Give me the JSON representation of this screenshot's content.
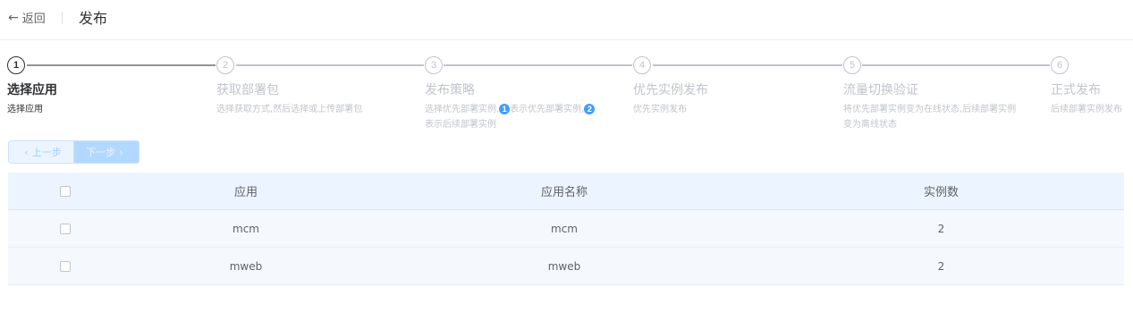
{
  "header": {
    "back_label": "返回",
    "title": "发布"
  },
  "steps": [
    {
      "number": "1",
      "title": "选择应用",
      "desc": [
        "选择应用"
      ]
    },
    {
      "number": "2",
      "title": "获取部署包",
      "desc": [
        "选择获取方式,然后选择或上传部署包"
      ]
    },
    {
      "number": "3",
      "title": "发布策略",
      "desc_prefix": "选择优先部署实例,",
      "badge1": "1",
      "desc_mid": "表示优先部署实例,",
      "badge2": "2",
      "desc_line2": "表示后续部署实例"
    },
    {
      "number": "4",
      "title": "优先实例发布",
      "desc": [
        "优先实例发布"
      ]
    },
    {
      "number": "5",
      "title": "流量切换验证",
      "desc": [
        "将优先部署实例变为在线状态,后续部署实例",
        "变为离线状态"
      ]
    },
    {
      "number": "6",
      "title": "正式发布",
      "desc": [
        "后续部署实例发布"
      ]
    }
  ],
  "buttons": {
    "prev": "上一步",
    "next": "下一步"
  },
  "table": {
    "columns": [
      "应用",
      "应用名称",
      "实例数"
    ],
    "rows": [
      {
        "app": "mcm",
        "name": "mcm",
        "instances": "2"
      },
      {
        "app": "mweb",
        "name": "mweb",
        "instances": "2"
      }
    ]
  },
  "colors": {
    "accent": "#409eff",
    "header_bg": "#ecf5ff",
    "inactive": "#c0c4cc"
  }
}
